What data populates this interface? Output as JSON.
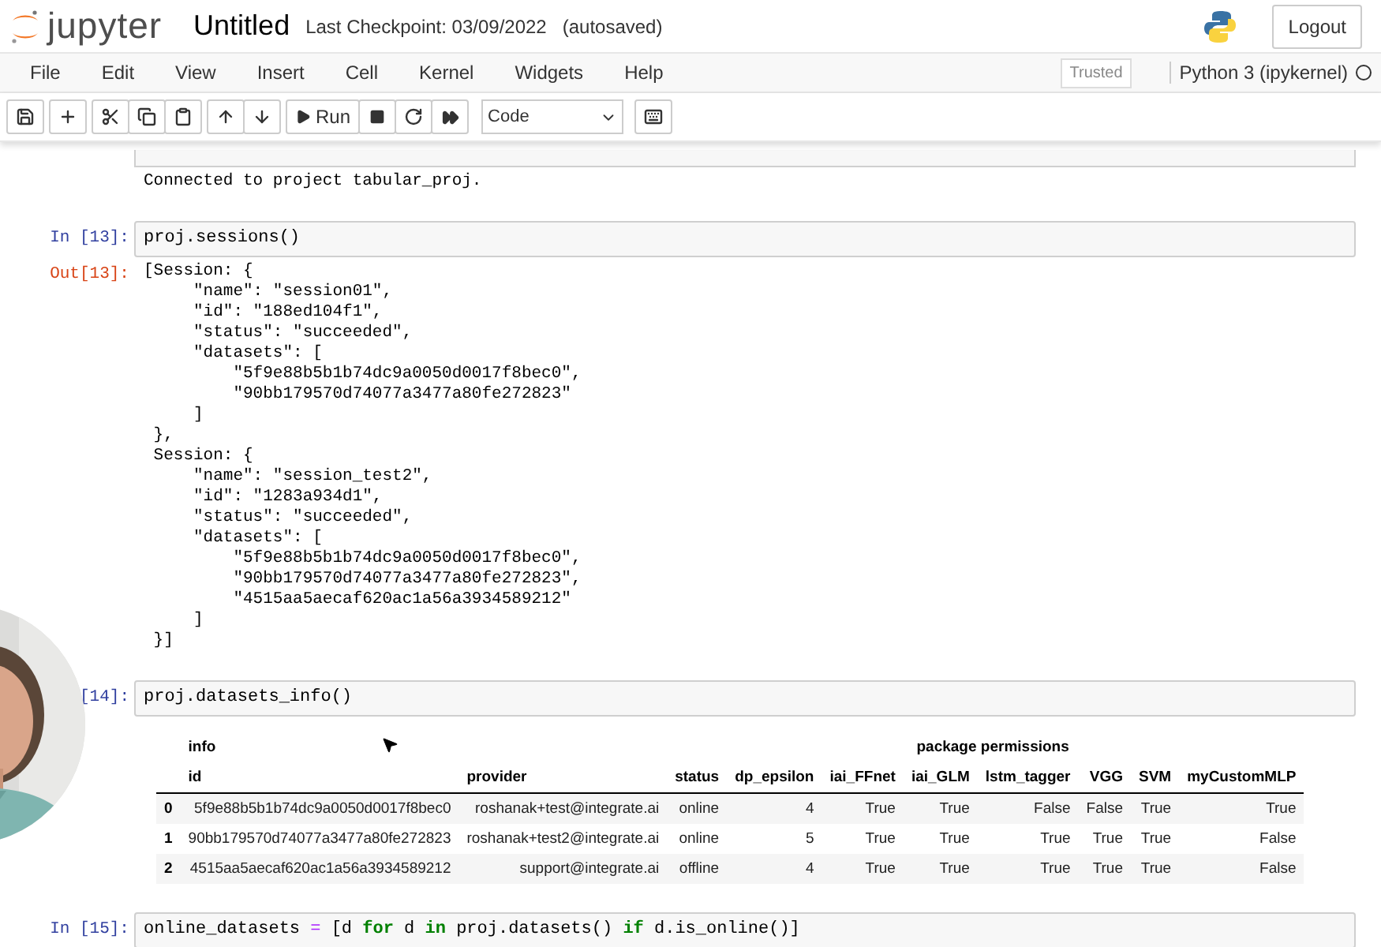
{
  "header": {
    "logo_text": "jupyter",
    "title": "Untitled",
    "checkpoint": "Last Checkpoint: 03/09/2022",
    "autosave": "(autosaved)",
    "logout": "Logout"
  },
  "menu": [
    "File",
    "Edit",
    "View",
    "Insert",
    "Cell",
    "Kernel",
    "Widgets",
    "Help"
  ],
  "trusted": "Trusted",
  "kernel": {
    "name": "Python 3 (ipykernel)",
    "busy": false
  },
  "toolbar": {
    "run": "Run",
    "cell_type": "Code"
  },
  "cells": [
    {
      "kind": "cut",
      "output": [
        "Connected to project tabular_proj."
      ]
    },
    {
      "kind": "code",
      "prompt": "In [13]:",
      "code": [
        {
          "text": "proj.sessions()",
          "kind": "plain"
        }
      ],
      "out_prompt": "Out[13]:",
      "output": [
        "[Session: {",
        "     \"name\": \"session01\",",
        "     \"id\": \"188ed104f1\",",
        "     \"status\": \"succeeded\",",
        "     \"datasets\": [",
        "         \"5f9e88b5b1b74dc9a0050d0017f8bec0\",",
        "         \"90bb179570d74077a3477a80fe272823\"",
        "     ]",
        " },",
        " Session: {",
        "     \"name\": \"session_test2\",",
        "     \"id\": \"1283a934d1\",",
        "     \"status\": \"succeeded\",",
        "     \"datasets\": [",
        "         \"5f9e88b5b1b74dc9a0050d0017f8bec0\",",
        "         \"90bb179570d74077a3477a80fe272823\",",
        "         \"4515aa5aecaf620ac1a56a3934589212\"",
        "     ]",
        " }]"
      ]
    },
    {
      "kind": "code",
      "prompt": "[14]:",
      "code": [
        {
          "text": "proj.datasets_info()",
          "kind": "plain"
        }
      ],
      "table": {
        "groups": [
          {
            "label": "info",
            "columns": [
              "id",
              "provider",
              "status",
              "dp_epsilon"
            ]
          },
          {
            "label": "package permissions",
            "columns": [
              "iai_FFnet",
              "iai_GLM",
              "lstm_tagger",
              "VGG",
              "SVM",
              "myCustomMLP"
            ]
          }
        ],
        "rows": [
          {
            "index": "0",
            "cells": [
              "5f9e88b5b1b74dc9a0050d0017f8bec0",
              "roshanak+test@integrate.ai",
              "online",
              "4",
              "True",
              "True",
              "False",
              "False",
              "True",
              "True"
            ]
          },
          {
            "index": "1",
            "cells": [
              "90bb179570d74077a3477a80fe272823",
              "roshanak+test2@integrate.ai",
              "online",
              "5",
              "True",
              "True",
              "True",
              "True",
              "True",
              "False"
            ]
          },
          {
            "index": "2",
            "cells": [
              "4515aa5aecaf620ac1a56a3934589212",
              "support@integrate.ai",
              "offline",
              "4",
              "True",
              "True",
              "True",
              "True",
              "True",
              "False"
            ]
          }
        ]
      }
    },
    {
      "kind": "code",
      "prompt": "In [15]:",
      "code": [
        {
          "text": "online_datasets ",
          "kind": "plain"
        },
        {
          "text": "=",
          "kind": "operator"
        },
        {
          "text": " [d ",
          "kind": "plain"
        },
        {
          "text": "for",
          "kind": "keyword"
        },
        {
          "text": " d ",
          "kind": "plain"
        },
        {
          "text": "in",
          "kind": "keyword"
        },
        {
          "text": " proj.datasets() ",
          "kind": "plain"
        },
        {
          "text": "if",
          "kind": "keyword"
        },
        {
          "text": " d.is_online()]",
          "kind": "plain"
        }
      ]
    }
  ]
}
